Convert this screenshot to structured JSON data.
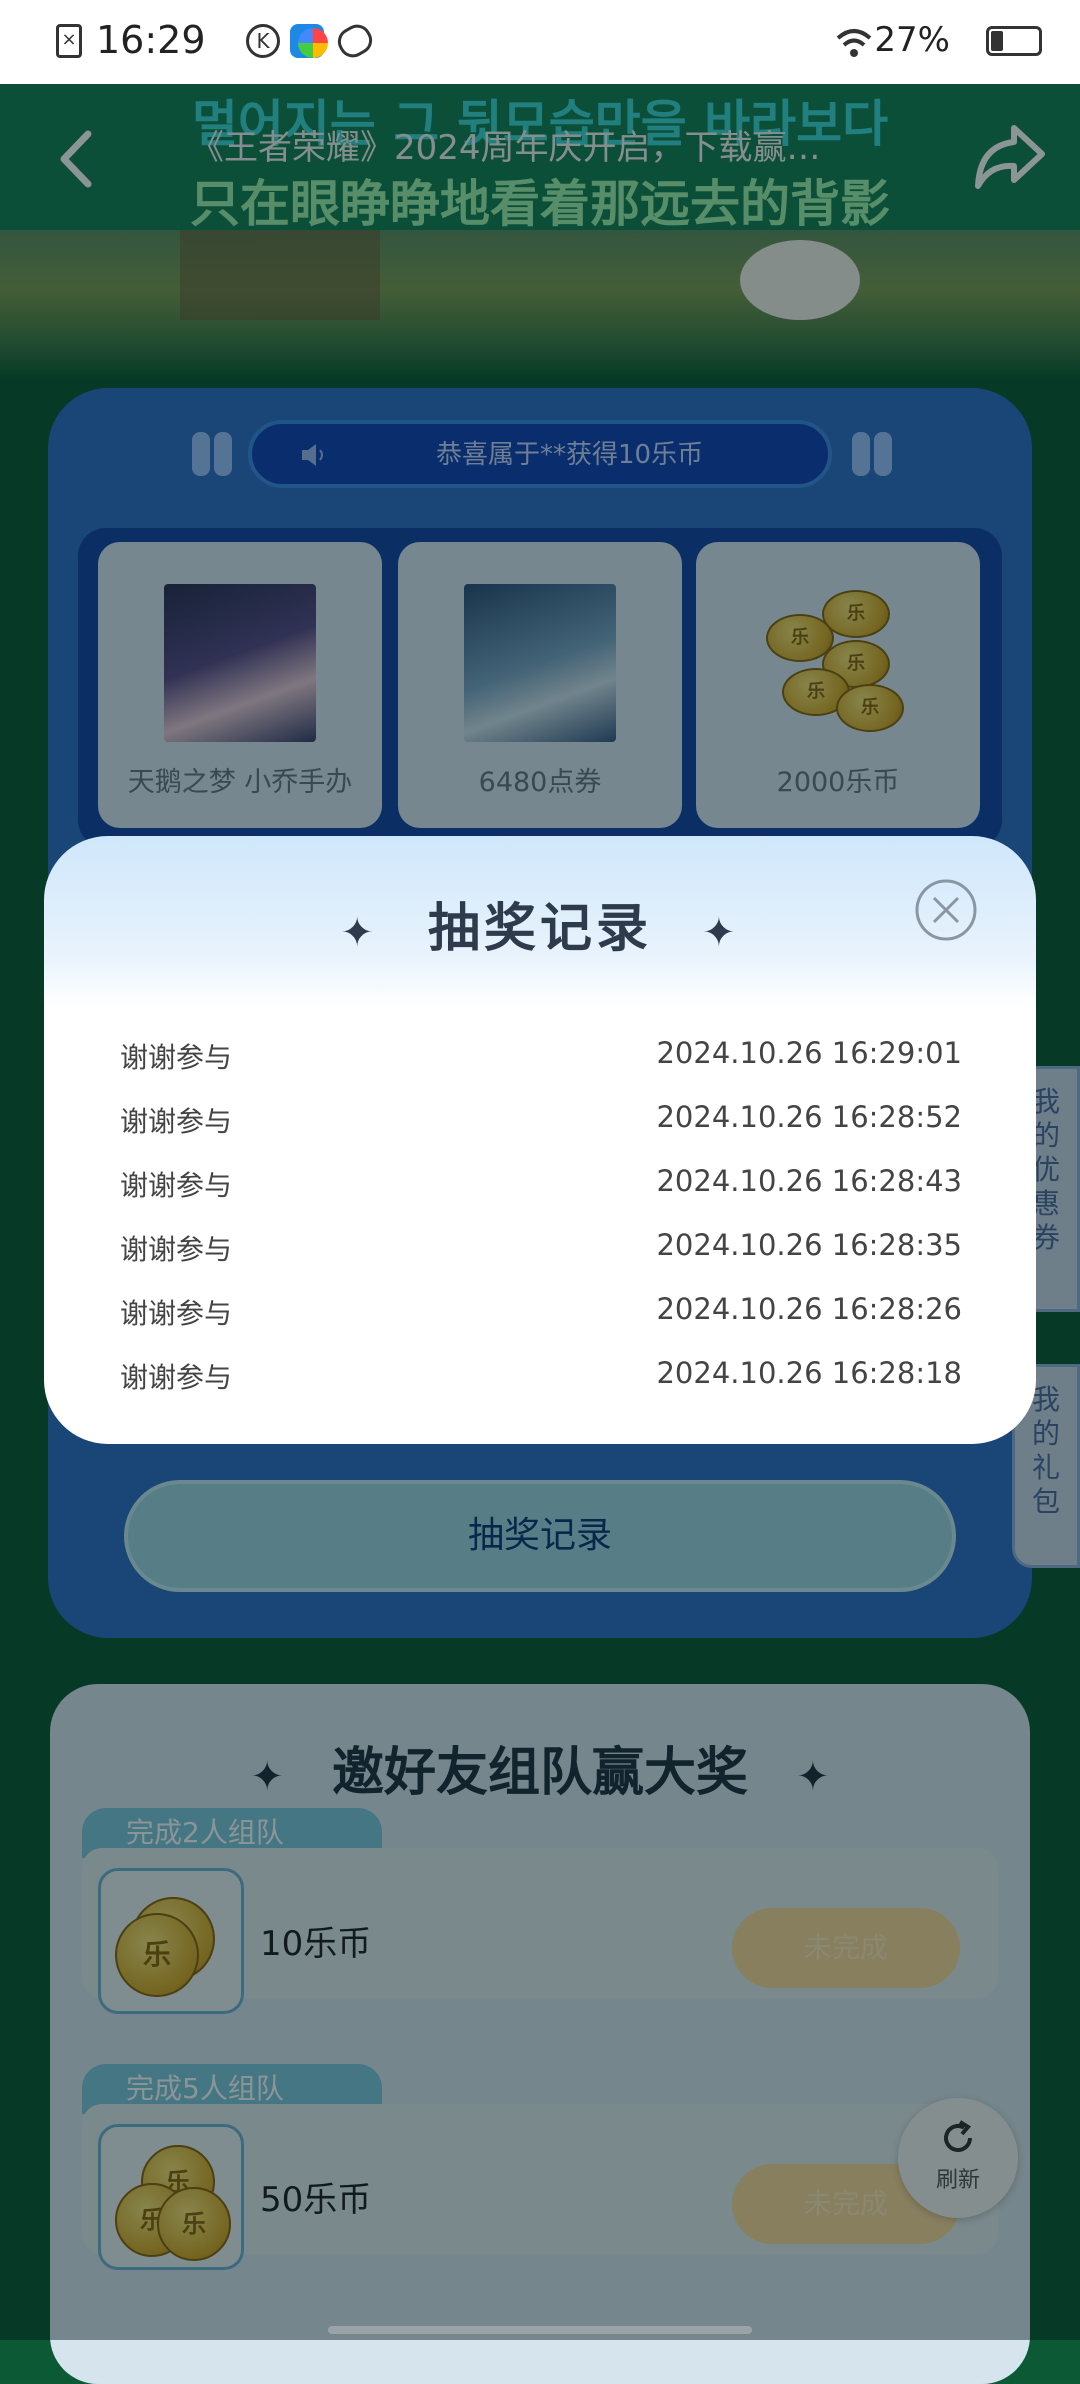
{
  "status_bar": {
    "time": "16:29",
    "icons": [
      "sim-error-icon",
      "k-app-icon",
      "k-blue-app-icon",
      "colorful-app-icon",
      "link-app-icon"
    ],
    "battery_text": "27%",
    "battery_level": 0.27
  },
  "header": {
    "lyric_top": "멀어지는 그 뒷모습만을 바라보다",
    "title": "《王者荣耀》2024周年庆开启，下载赢…",
    "lyric_bottom": "只在眼睁睁地看着那远去的背影"
  },
  "lottery": {
    "ticker": "恭喜属于**获得10乐币",
    "prizes": [
      {
        "label": "天鹅之梦 小乔手办"
      },
      {
        "label": "6480点券"
      },
      {
        "label": "2000乐币"
      }
    ],
    "records_button": "抽奖记录"
  },
  "side_tabs": {
    "coupons": "我的优惠券",
    "gifts": "我的礼包"
  },
  "invite": {
    "title": "邀好友组队赢大奖",
    "tasks": [
      {
        "tab": "完成2人组队",
        "reward": "10乐币",
        "status": "未完成"
      },
      {
        "tab": "完成5人组队",
        "reward": "50乐币",
        "status": "未完成"
      }
    ]
  },
  "refresh": {
    "label": "刷新"
  },
  "modal": {
    "title": "抽奖记录",
    "records": [
      {
        "result": "谢谢参与",
        "time": "2024.10.26 16:29:01"
      },
      {
        "result": "谢谢参与",
        "time": "2024.10.26 16:28:52"
      },
      {
        "result": "谢谢参与",
        "time": "2024.10.26 16:28:43"
      },
      {
        "result": "谢谢参与",
        "time": "2024.10.26 16:28:35"
      },
      {
        "result": "谢谢参与",
        "time": "2024.10.26 16:28:26"
      },
      {
        "result": "谢谢参与",
        "time": "2024.10.26 16:28:18"
      }
    ]
  },
  "colors": {
    "header_green": "#178056",
    "lottery_blue": "#2f6fc9",
    "modal_title": "#2d3b4c"
  }
}
